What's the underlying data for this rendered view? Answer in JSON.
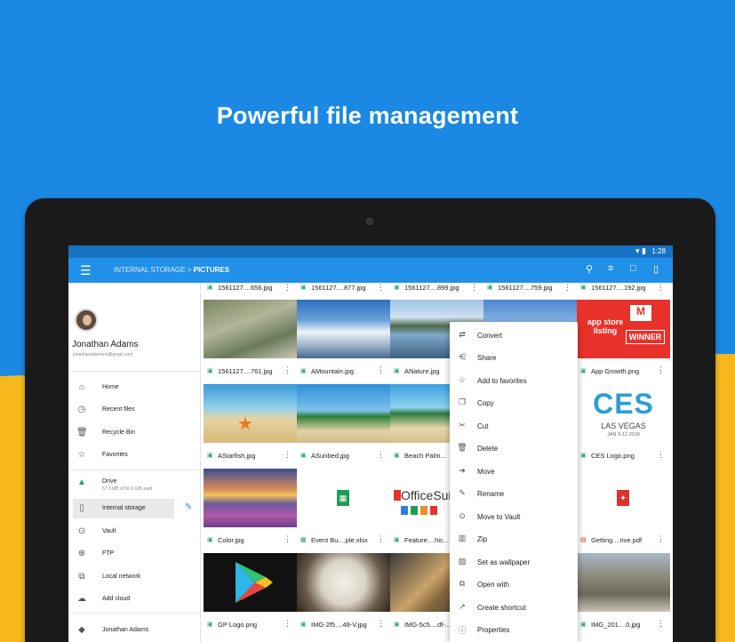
{
  "headline": "Powerful file management",
  "status": {
    "time": "1:28"
  },
  "appbar": {
    "crumb_root": "INTERNAL STORAGE",
    "crumb_sep": ">",
    "crumb_current": "PICTURES"
  },
  "drawer": {
    "user_name": "Jonathan Adams",
    "user_email": "jonathanadamsns@gmail.com",
    "items": [
      {
        "label": "Home",
        "icon": "home-icon"
      },
      {
        "label": "Recent files",
        "icon": "clock-icon"
      },
      {
        "label": "Recycle Bin",
        "icon": "trash-icon"
      },
      {
        "label": "Favorites",
        "icon": "star-icon"
      },
      {
        "label": "Drive",
        "icon": "drive-icon",
        "sub": "57.3 MB of 50.0 GB used"
      },
      {
        "label": "Internal storage",
        "icon": "phone-icon"
      },
      {
        "label": "Vault",
        "icon": "lock-icon"
      },
      {
        "label": "FTP",
        "icon": "globe-icon"
      },
      {
        "label": "Local network",
        "icon": "network-icon"
      },
      {
        "label": "Add cloud",
        "icon": "cloud-icon"
      },
      {
        "label": "Jonathan Adams",
        "icon": "dropbox-icon"
      }
    ]
  },
  "top_files": [
    "1561127....656.jpg",
    "1561127....877.jpg",
    "1561127....899.jpg",
    "1561127....759.jpg",
    "1561127....192.jpg"
  ],
  "files": [
    [
      "1561127....761.jpg",
      "AMountain.jpg",
      "ANature.jpg",
      "",
      "App Growth.png"
    ],
    [
      "AStarfish.jpg",
      "ASunbed.jpg",
      "Beach Palm...",
      "",
      "CES Logo.png"
    ],
    [
      "Color.jpg",
      "Event Bu....ple.xlsx",
      "Feature....hic...",
      "",
      "Getting....rive.pdf"
    ],
    [
      "GP Logo.png",
      "IMG-2f5....48-V.jpg",
      "IMG-5c5....df-...",
      "",
      "IMG_201....0.jpg"
    ]
  ],
  "thumb_text": {
    "app_growth": "app store listing",
    "app_growth_badge": "WINNER",
    "ces_logo": "CES",
    "ces_city": "LAS VEGAS",
    "ces_date": "JAN 9-12 2018",
    "office_suite": "OfficeSuite"
  },
  "context_menu": [
    {
      "label": "Convert",
      "icon": "convert-icon"
    },
    {
      "label": "Share",
      "icon": "share-icon"
    },
    {
      "label": "Add to favorites",
      "icon": "star-icon"
    },
    {
      "label": "Copy",
      "icon": "copy-icon"
    },
    {
      "label": "Cut",
      "icon": "scissors-icon"
    },
    {
      "label": "Delete",
      "icon": "trash-icon"
    },
    {
      "label": "Move",
      "icon": "move-icon"
    },
    {
      "label": "Rename",
      "icon": "edit-icon"
    },
    {
      "label": "Move to Vault",
      "icon": "lock-icon"
    },
    {
      "label": "Zip",
      "icon": "zip-icon"
    },
    {
      "label": "Set as wallpaper",
      "icon": "wallpaper-icon"
    },
    {
      "label": "Open with",
      "icon": "open-with-icon"
    },
    {
      "label": "Create shortcut",
      "icon": "shortcut-icon"
    },
    {
      "label": "Properties",
      "icon": "info-icon"
    }
  ],
  "colors": {
    "brand_blue": "#2190e8",
    "background_blue": "#1b89e3",
    "background_yellow": "#f6b81d"
  }
}
